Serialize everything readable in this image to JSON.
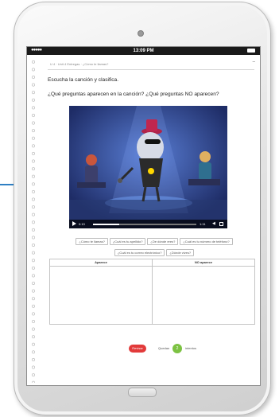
{
  "status_bar": {
    "signal": "●●●●●",
    "time": "13:09 PM"
  },
  "breadcrumb": "U 4 · Unit 4 Entregas · ¿Cómo te llamas?",
  "instruction": "Escucha la canción y clasifica.",
  "question": "¿Qué preguntas aparecen en la canción? ¿Qué preguntas NO aparecen?",
  "video": {
    "time_current": "0:13",
    "time_total": "1:11",
    "progress": 0.25
  },
  "chips": [
    "¿Cómo te llamas?",
    "¿Cuál es tu apellido?",
    "¿De dónde eres?",
    "¿Cuál es tu número de teléfono?",
    "¿Cuál es tu correo electrónico?",
    "¿Dónde vives?"
  ],
  "table": {
    "col_left": "Aparece",
    "col_right": "NO aparece"
  },
  "footer": {
    "check_label": "Revisar",
    "quedan_label": "Quedan",
    "count": "2",
    "intentos_label": "intentos"
  },
  "colors": {
    "check_button": "#e23a3a",
    "count_badge": "#7cc242",
    "arrow": "#2f7fc3",
    "video_background": "#1e2c66"
  }
}
